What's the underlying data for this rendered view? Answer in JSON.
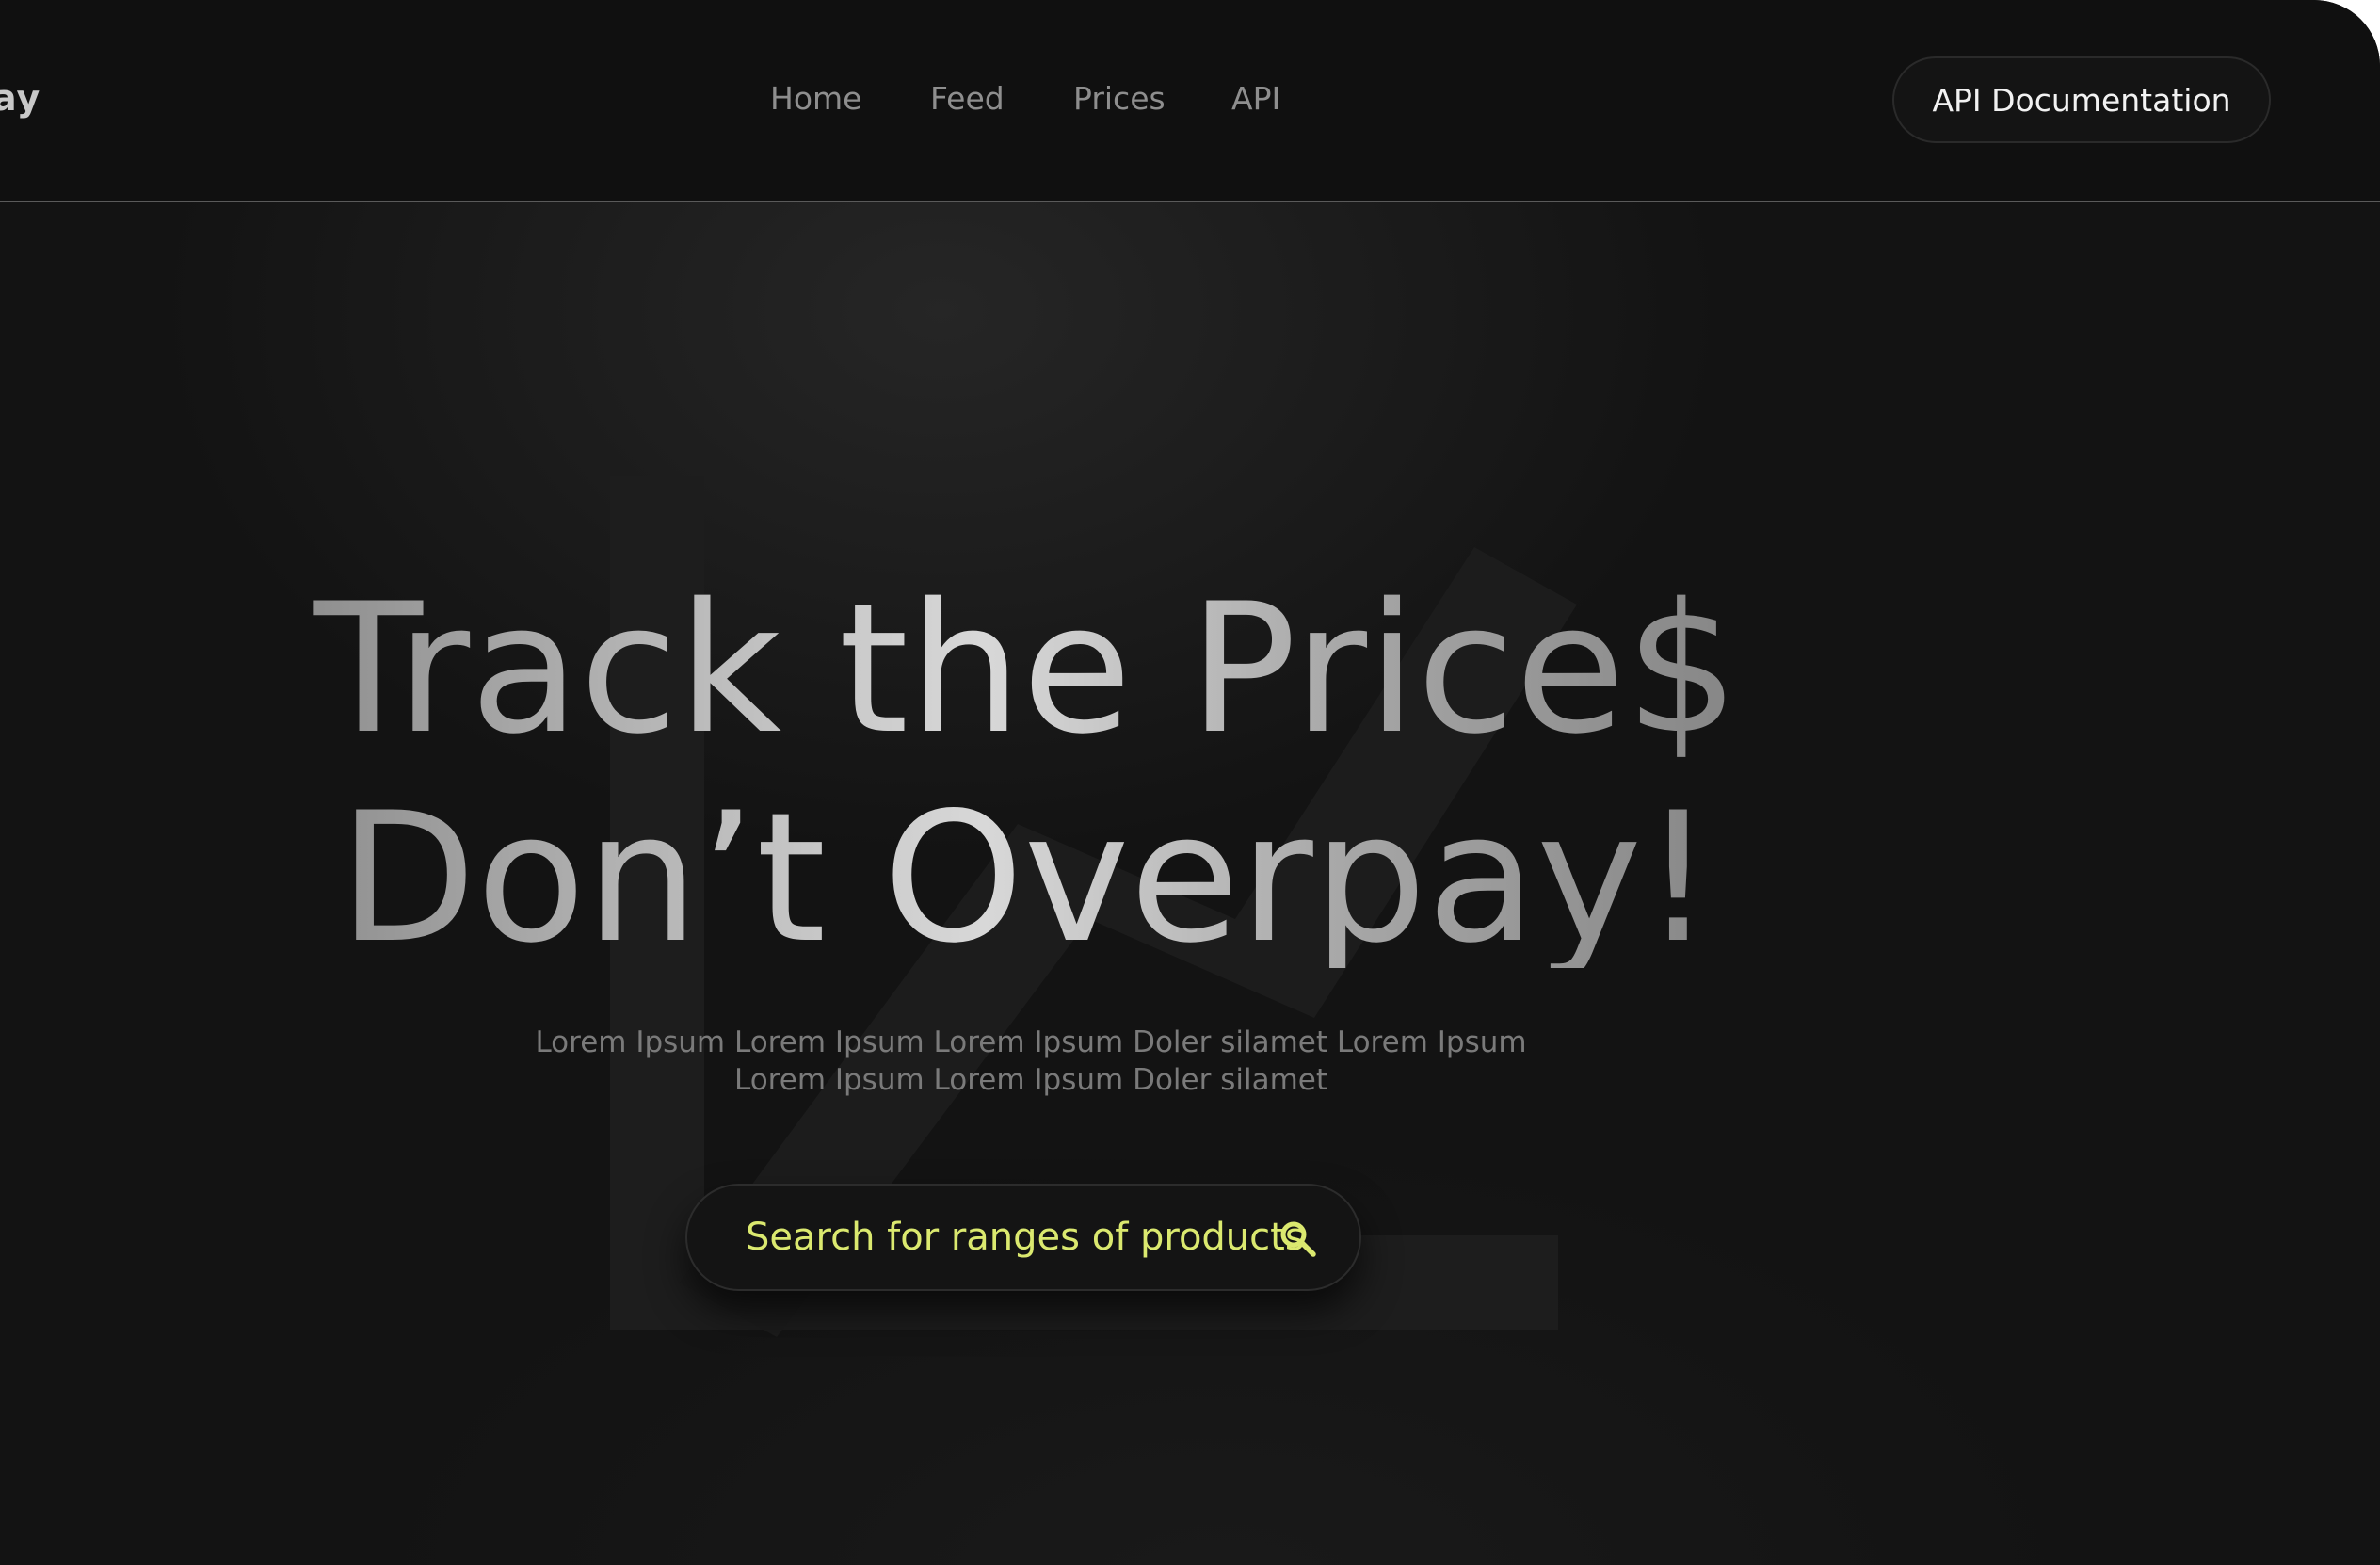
{
  "header": {
    "logo_text": "ay",
    "nav": [
      {
        "label": "Home"
      },
      {
        "label": "Feed"
      },
      {
        "label": "Prices"
      },
      {
        "label": "API"
      }
    ],
    "cta_label": "API Documentation"
  },
  "hero": {
    "headline_line1": "Track the Price$",
    "headline_line2": "Don’t Overpay!",
    "subtitle": "Lorem Ipsum Lorem Ipsum Lorem Ipsum Doler silamet Lorem Ipsum Lorem Ipsum Lorem Ipsum Doler silamet",
    "search_placeholder": "Search for ranges of products"
  },
  "icons": {
    "search": "search-icon",
    "background_chart": "chart-line-icon"
  },
  "colors": {
    "background": "#131313",
    "header_background": "#101010",
    "accent": "#dbe96f",
    "nav_text": "#8e8e8e"
  }
}
